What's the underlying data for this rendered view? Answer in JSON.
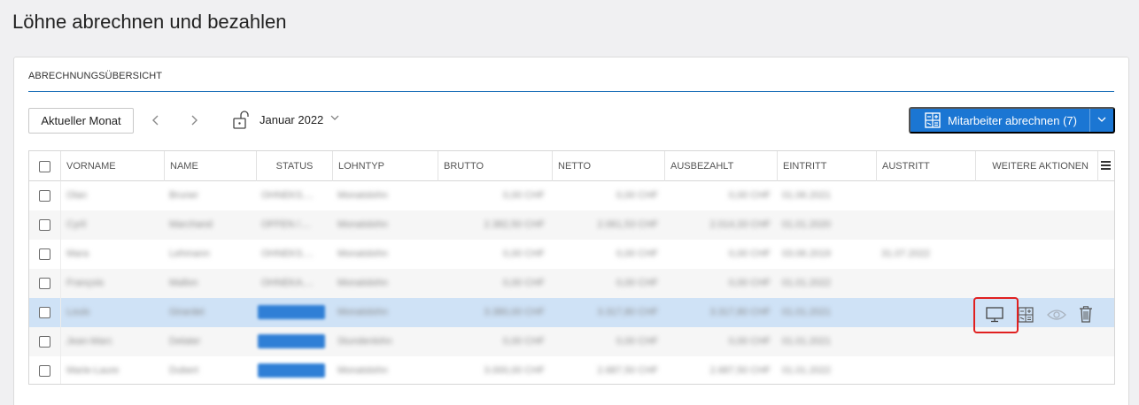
{
  "page": {
    "title": "Löhne abrechnen und bezahlen"
  },
  "card": {
    "header": "ABRECHNUNGSÜBERSICHT"
  },
  "toolbar": {
    "current_month_label": "Aktueller Monat",
    "month_label": "Januar 2022",
    "primary_button_label": "Mitarbeiter abrechnen (7)"
  },
  "table": {
    "columns": [
      "VORNAME",
      "NAME",
      "STATUS",
      "LOHNTYP",
      "BRUTTO",
      "NETTO",
      "AUSBEZAHLT",
      "EINTRITT",
      "AUSTRITT",
      "WEITERE AKTIONEN"
    ],
    "rows": [
      {
        "vorname": "Olan",
        "name": "Bruner",
        "status": "OHNEKS....",
        "lohntyp": "Monatslohn",
        "brutto": "0,00 CHF",
        "netto": "0,00 CHF",
        "ausbezahlt": "0,00 CHF",
        "eintritt": "01.06.2021",
        "austritt": "",
        "status_pill": false
      },
      {
        "vorname": "Cyril",
        "name": "Marchand",
        "status": "OFFEN /....",
        "lohntyp": "Monatslohn",
        "brutto": "2.382,50 CHF",
        "netto": "2.061,53 CHF",
        "ausbezahlt": "2.014,33 CHF",
        "eintritt": "01.01.2020",
        "austritt": "",
        "status_pill": false
      },
      {
        "vorname": "Mara",
        "name": "Lehmann",
        "status": "OHNEKS....",
        "lohntyp": "Monatslohn",
        "brutto": "0,00 CHF",
        "netto": "0,00 CHF",
        "ausbezahlt": "0,00 CHF",
        "eintritt": "03.06.2019",
        "austritt": "31.07.2022",
        "status_pill": false
      },
      {
        "vorname": "François",
        "name": "Mallon",
        "status": "OHNEKA....",
        "lohntyp": "Monatslohn",
        "brutto": "0,00 CHF",
        "netto": "0,00 CHF",
        "ausbezahlt": "0,00 CHF",
        "eintritt": "01.01.2022",
        "austritt": "",
        "status_pill": false
      },
      {
        "vorname": "Louis",
        "name": "Girardet",
        "status": "",
        "lohntyp": "Monatslohn",
        "brutto": "3.380,00 CHF",
        "netto": "3.317,80 CHF",
        "ausbezahlt": "3.317,80 CHF",
        "eintritt": "01.01.2021",
        "austritt": "",
        "status_pill": true
      },
      {
        "vorname": "Jean-Marc",
        "name": "Delater",
        "status": "",
        "lohntyp": "Stundenlohn",
        "brutto": "0,00 CHF",
        "netto": "0,00 CHF",
        "ausbezahlt": "0,00 CHF",
        "eintritt": "01.01.2021",
        "austritt": "",
        "status_pill": true
      },
      {
        "vorname": "Marie-Laure",
        "name": "Dubert",
        "status": "",
        "lohntyp": "Monatslohn",
        "brutto": "3.000,00 CHF",
        "netto": "2.687,50 CHF",
        "ausbezahlt": "2.687,50 CHF",
        "eintritt": "01.01.2022",
        "austritt": "",
        "status_pill": true
      }
    ]
  },
  "icons": {
    "prev": "chevron-left-icon",
    "next": "chevron-right-icon",
    "lock": "unlock-icon",
    "month_dropdown": "chevron-down-icon",
    "primary": "calculator-icon",
    "column_menu": "menu-icon",
    "actions": [
      "monitor-icon",
      "calculator-icon",
      "eye-icon",
      "trash-icon"
    ]
  },
  "colors": {
    "accent": "#1b76d3",
    "selected_row": "#cfe2f6",
    "highlight": "#e02020"
  }
}
